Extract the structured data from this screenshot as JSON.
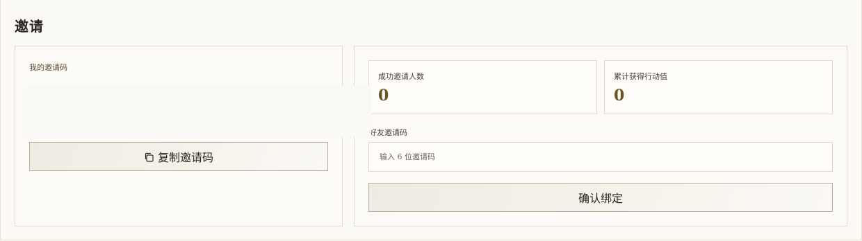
{
  "page": {
    "title": "邀请"
  },
  "invite_code_card": {
    "label": "我的邀请码",
    "code": "",
    "copy_button_label": "复制邀请码",
    "copy_icon": "copy-icon"
  },
  "stats": [
    {
      "label": "成功邀请人数",
      "value": "0"
    },
    {
      "label": "累计获得行动值",
      "value": "0"
    }
  ],
  "bind": {
    "label": "好友邀请码",
    "input_placeholder": "输入 6 位邀请码",
    "input_value": "",
    "confirm_button_label": "确认绑定"
  },
  "colors": {
    "background": "#faf7f1",
    "accent_text": "#6a5326",
    "button_border": "#b9ad98"
  }
}
